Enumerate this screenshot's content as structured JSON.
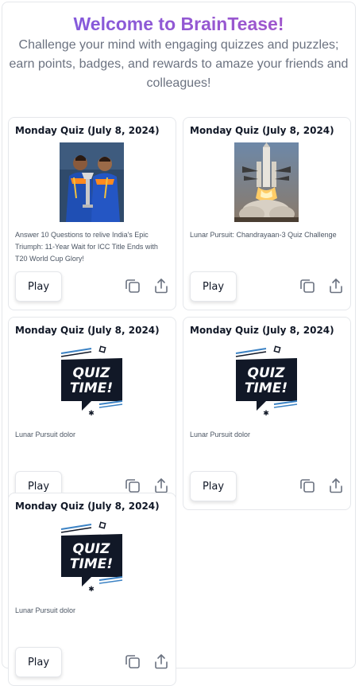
{
  "header": {
    "title": "Welcome to BrainTease!",
    "subtitle": "Challenge your mind with engaging quizzes and puzzles; earn points, badges, and rewards to amaze your friends and colleagues!"
  },
  "cards": [
    {
      "date": "Monday Quiz (July 8, 2024)",
      "image": "cricket-players-trophy-photo",
      "description": "Answer 10 Questions to relive India's Epic Triumph: 11-Year Wait for ICC Title Ends with T20 World Cup Glory!",
      "play_label": "Play"
    },
    {
      "date": "Monday Quiz (July 8, 2024)",
      "image": "rocket-launch-photo",
      "description": "Lunar Pursuit: Chandrayaan-3 Quiz Challenge",
      "play_label": "Play"
    },
    {
      "date": "Monday Quiz (July 8, 2024)",
      "image": "quiz-time-graphic",
      "quiz_text": [
        "QUIZ",
        "TIME!"
      ],
      "description": "Lunar Pursuit dolor",
      "play_label": "Play"
    },
    {
      "date": "Monday Quiz (July 8, 2024)",
      "image": "quiz-time-graphic",
      "quiz_text": [
        "QUIZ",
        "TIME!"
      ],
      "description": "Lunar Pursuit dolor",
      "play_label": "Play"
    },
    {
      "date": "Monday Quiz (July 8, 2024)",
      "image": "quiz-time-graphic",
      "quiz_text": [
        "QUIZ",
        "TIME!"
      ],
      "description": "Lunar Pursuit dolor",
      "play_label": "Play"
    }
  ],
  "colors": {
    "title_gradient_start": "#7c5ce0",
    "title_gradient_end": "#a855c7",
    "quiz_badge": "#111827",
    "quiz_stripe": "#3b82c4"
  }
}
